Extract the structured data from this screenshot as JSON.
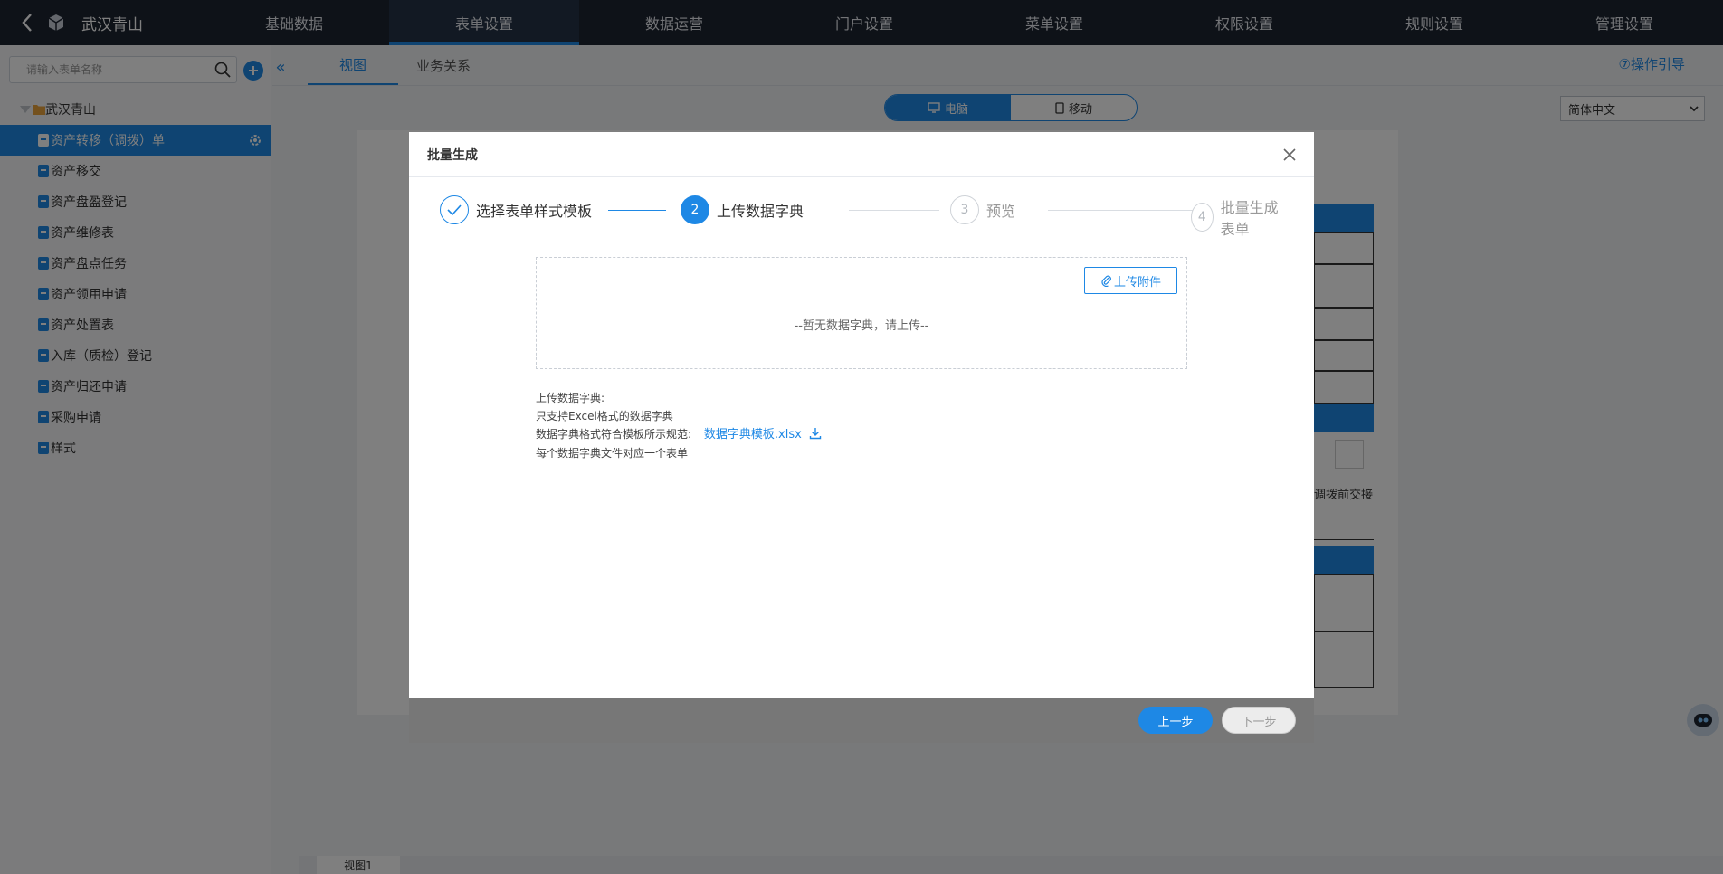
{
  "app": {
    "name": "武汉青山"
  },
  "nav": [
    "基础数据",
    "表单设置",
    "数据运营",
    "门户设置",
    "菜单设置",
    "权限设置",
    "规则设置",
    "管理设置"
  ],
  "sidebar": {
    "search_placeholder": "请输入表单名称",
    "root": "武汉青山",
    "items": [
      "资产转移（调拨）单",
      "资产移交",
      "资产盘盈登记",
      "资产维修表",
      "资产盘点任务",
      "资产领用申请",
      "资产处置表",
      "入库（质检）登记",
      "资产归还申请",
      "采购申请",
      "样式"
    ]
  },
  "tabs": [
    "视图",
    "业务关系"
  ],
  "guide": "⑦操作引导",
  "device": {
    "pc": "电脑",
    "mobile": "移动"
  },
  "language": "简体中文",
  "bg_form_text": "调拨前交接",
  "bottom_tab": "视图1",
  "modal": {
    "title": "批量生成",
    "steps": [
      {
        "num": "",
        "label": "选择表单样式模板",
        "state": "done"
      },
      {
        "num": "2",
        "label": "上传数据字典",
        "state": "cur"
      },
      {
        "num": "3",
        "label": "预览",
        "state": "todo"
      },
      {
        "num": "4",
        "label": "批量生成表单",
        "state": "todo"
      }
    ],
    "upload_button": "上传附件",
    "empty_text": "--暂无数据字典，请上传--",
    "notes": {
      "line1": "上传数据字典:",
      "line2": "只支持Excel格式的数据字典",
      "line3": "数据字典格式符合模板所示规范:",
      "template_link": "数据字典模板.xlsx",
      "line4": "每个数据字典文件对应一个表单"
    },
    "prev_button": "上一步",
    "next_button": "下一步"
  },
  "colors": {
    "primary": "#1e88e5",
    "topbar": "#1c2431"
  }
}
